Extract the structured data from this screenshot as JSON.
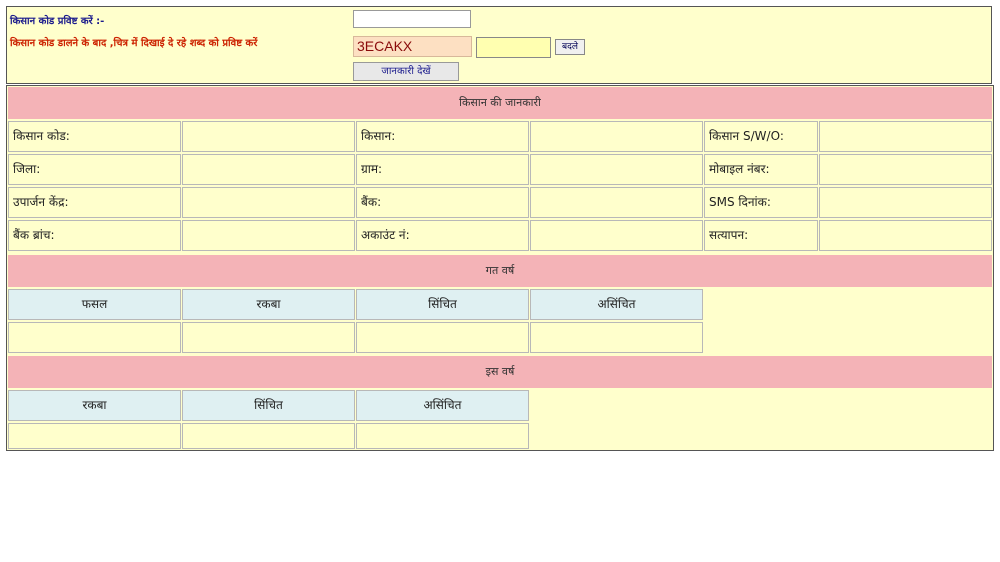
{
  "form": {
    "kisan_code_label": "किसान कोड प्रविष्ट करें :-",
    "captcha_instruction": "किसान कोड डालने के बाद ,चित्र में दिखाई दे रहे शब्द को प्रविष्ट करें",
    "kisan_code_value": "",
    "captcha_text": "3ECAKX",
    "captcha_input_value": "",
    "change_button": "बदले",
    "view_button": "जानकारी देखें"
  },
  "info": {
    "header": "किसान की जानकारी",
    "rows": [
      [
        "किसान कोड:",
        "",
        "किसान:",
        "",
        "किसान S/W/O:",
        ""
      ],
      [
        "जिला:",
        "",
        "ग्राम:",
        "",
        "मोबाइल नंबर:",
        ""
      ],
      [
        "उपार्जन केंद्र:",
        "",
        "बैंक:",
        "",
        "SMS दिनांक:",
        ""
      ],
      [
        "बैंक ब्रांच:",
        "",
        "अकाउंट नं:",
        "",
        "सत्यापन:",
        ""
      ]
    ]
  },
  "last_year": {
    "header": "गत वर्ष",
    "columns": [
      "फसल",
      "रकबा",
      "सिंचित",
      "असिंचित"
    ],
    "row": [
      "",
      "",
      "",
      ""
    ]
  },
  "this_year": {
    "header": "इस वर्ष",
    "columns": [
      "रकबा",
      "सिंचित",
      "असिंचित"
    ],
    "row": [
      "",
      "",
      ""
    ]
  }
}
